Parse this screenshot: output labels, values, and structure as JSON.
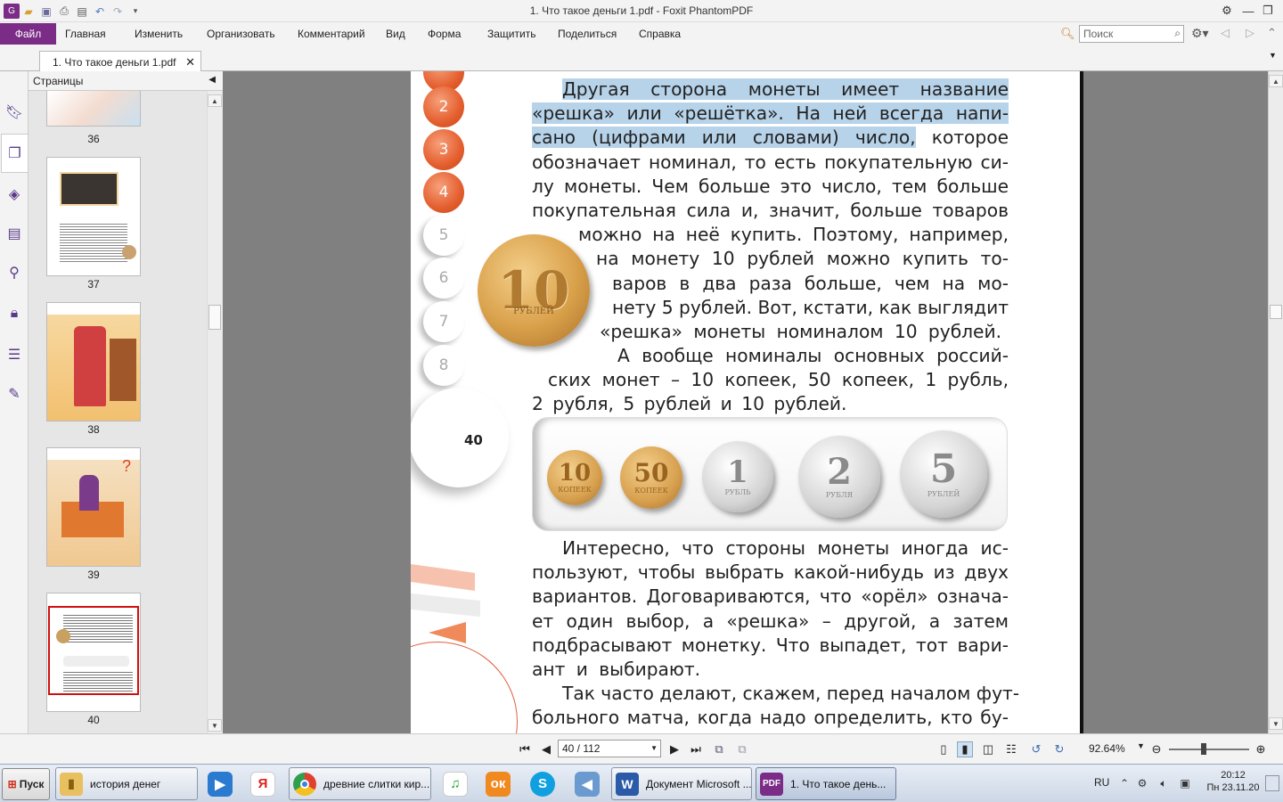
{
  "titlebar": {
    "title": "1. Что такое деньги 1.pdf - Foxit PhantomPDF",
    "quick_access": [
      "app-icon",
      "open-icon",
      "save-icon",
      "print-icon",
      "properties-icon",
      "undo-icon",
      "redo-icon",
      "customize-icon"
    ]
  },
  "ribbon": {
    "file_tab": "Файл",
    "tabs": [
      "Главная",
      "Изменить",
      "Организовать",
      "Комментарий",
      "Вид",
      "Форма",
      "Защитить",
      "Поделиться",
      "Справка"
    ],
    "search_placeholder": "Поиск"
  },
  "document_tab": {
    "label": "1. Что такое деньги 1.pdf",
    "close": "✕"
  },
  "pages_panel": {
    "title": "Страницы",
    "thumbnails": [
      {
        "number": "36"
      },
      {
        "number": "37"
      },
      {
        "number": "38"
      },
      {
        "number": "39"
      },
      {
        "number": "40",
        "selected": true
      }
    ]
  },
  "page": {
    "paragraph1": [
      {
        "highlight": "Другая сторона монеты имеет название"
      },
      {
        "highlight": "«решка» или «решётка». На ней всегда напи-"
      },
      {
        "highlight": "сано (цифрами или словами) число,",
        "rest": " которое"
      },
      {
        "text": "обозначает номинал, то есть покупательную си-"
      },
      {
        "text": "лу монеты. Чем больше это число, тем больше"
      },
      {
        "text": "покупательная сила и, значит, больше товаров"
      },
      {
        "text": "можно на неё купить. Поэтому, например,"
      },
      {
        "text": "на монету 10 рублей можно купить то-"
      },
      {
        "text": "варов в два раза больше, чем на мо-"
      },
      {
        "text": "нету 5 рублей. Вот, кстати, как выглядит"
      },
      {
        "text": "«решка» монеты номиналом 10 рублей."
      },
      {
        "text": "А вообще номиналы основных россий-"
      },
      {
        "text": "ских монет – 10 копеек, 50 копеек, 1 рубль,"
      },
      {
        "text": "2 рубля, 5 рублей и 10 рублей."
      }
    ],
    "side_numbers": [
      "2",
      "3",
      "4",
      "5",
      "6",
      "7",
      "8"
    ],
    "page_number": "40",
    "big_coin": {
      "value": "10",
      "label": "РУБЛЕЙ"
    },
    "coins": [
      {
        "value": "10",
        "label": "КОПЕЕК",
        "metal": "gold"
      },
      {
        "value": "50",
        "label": "КОПЕЕК",
        "metal": "gold"
      },
      {
        "value": "1",
        "label": "РУБЛЬ",
        "metal": "silver"
      },
      {
        "value": "2",
        "label": "РУБЛЯ",
        "metal": "silver"
      },
      {
        "value": "5",
        "label": "РУБЛЕЙ",
        "metal": "silver"
      }
    ],
    "paragraph2": [
      "Интересно, что стороны монеты иногда ис-",
      "пользуют, чтобы выбрать какой-нибудь из двух",
      "вариантов. Договариваются, что «орёл» означа-",
      "ет один выбор, а «решка» – другой, а затем",
      "подбрасывают монетку. Что выпадет, тот вари-",
      "ант и выбирают.",
      "Так часто делают, скажем, перед началом фут-",
      "больного матча, когда надо определить, кто бу-"
    ]
  },
  "statusbar": {
    "page_field": "40 / 112",
    "zoom": "92.64%"
  },
  "taskbar": {
    "start": "Пуск",
    "windows": [
      {
        "label": "история денег",
        "icon": "folder-icon"
      },
      {
        "label": "древние слитки кир...",
        "icon": "chrome-icon"
      },
      {
        "label": "Документ Microsoft ...",
        "icon": "word-icon"
      },
      {
        "label": "1. Что такое день...",
        "icon": "pdf-icon",
        "active": true
      }
    ],
    "language": "RU",
    "time": "20:12",
    "date": "Пн 23.11.20"
  },
  "colors": {
    "file_tab": "#7b2c87",
    "highlight": "#b7d3ea",
    "orange_circle": "#e45e2e",
    "doc_background": "#808080"
  }
}
